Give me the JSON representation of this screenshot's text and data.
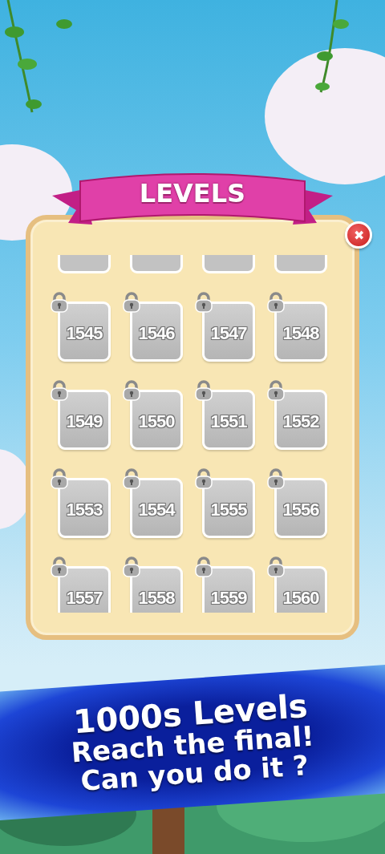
{
  "dialog": {
    "title": "LEVELS",
    "close_label": "✖"
  },
  "levels": [
    {
      "number": "1545",
      "locked": true
    },
    {
      "number": "1546",
      "locked": true
    },
    {
      "number": "1547",
      "locked": true
    },
    {
      "number": "1548",
      "locked": true
    },
    {
      "number": "1549",
      "locked": true
    },
    {
      "number": "1550",
      "locked": true
    },
    {
      "number": "1551",
      "locked": true
    },
    {
      "number": "1552",
      "locked": true
    },
    {
      "number": "1553",
      "locked": true
    },
    {
      "number": "1554",
      "locked": true
    },
    {
      "number": "1555",
      "locked": true
    },
    {
      "number": "1556",
      "locked": true
    },
    {
      "number": "1557",
      "locked": true
    },
    {
      "number": "1558",
      "locked": true
    },
    {
      "number": "1559",
      "locked": true
    },
    {
      "number": "1560",
      "locked": true
    }
  ],
  "promo": {
    "lines": [
      "1000s Levels",
      "Reach the final!",
      "Can you do it ?"
    ]
  }
}
